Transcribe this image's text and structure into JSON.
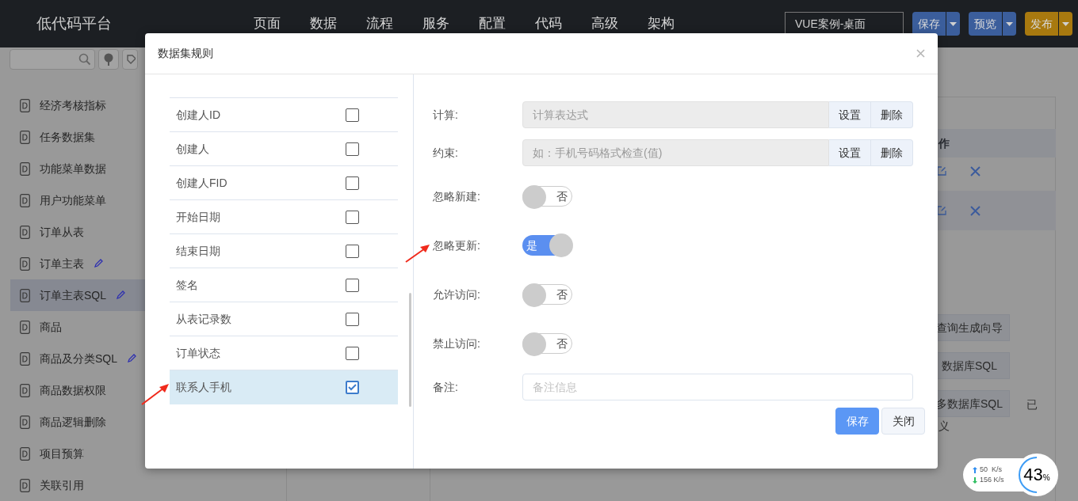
{
  "app": {
    "title": "低代码平台",
    "nav": [
      "页面",
      "数据",
      "流程",
      "服务",
      "配置",
      "代码",
      "高级",
      "架构"
    ],
    "project_select": "VUE案例-桌面",
    "buttons": [
      {
        "label": "保存",
        "color": "#3b5e9c"
      },
      {
        "label": "预览",
        "color": "#3b5e9c"
      },
      {
        "label": "发布",
        "color": "#a8790f"
      }
    ]
  },
  "sidebar": {
    "items": [
      {
        "label": "经济考核指标",
        "selected": false,
        "edited": false
      },
      {
        "label": "任务数据集",
        "selected": false,
        "edited": false
      },
      {
        "label": "功能菜单数据",
        "selected": false,
        "edited": false
      },
      {
        "label": "用户功能菜单",
        "selected": false,
        "edited": false
      },
      {
        "label": "订单从表",
        "selected": false,
        "edited": false
      },
      {
        "label": "订单主表",
        "selected": false,
        "edited": true
      },
      {
        "label": "订单主表SQL",
        "selected": true,
        "edited": true
      },
      {
        "label": "商品",
        "selected": false,
        "edited": false
      },
      {
        "label": "商品及分类SQL",
        "selected": false,
        "edited": true
      },
      {
        "label": "商品数据权限",
        "selected": false,
        "edited": false
      },
      {
        "label": "商品逻辑删除",
        "selected": false,
        "edited": false
      },
      {
        "label": "项目预算",
        "selected": false,
        "edited": false
      },
      {
        "label": "关联引用",
        "selected": false,
        "edited": false
      }
    ]
  },
  "main": {
    "table_header": "作",
    "buttons": [
      "查询生成向导",
      "数据库SQL",
      "多数据库SQL"
    ],
    "side_text": "已",
    "wrapped_text": "义"
  },
  "net_widget": {
    "upload": "50  K/s",
    "download": "156 K/s",
    "percent": "43",
    "percent_sign": "%"
  },
  "dialog": {
    "title": "数据集规则",
    "fields": [
      {
        "name": "创建人ID",
        "checked": false,
        "selected": false
      },
      {
        "name": "创建人",
        "checked": false,
        "selected": false
      },
      {
        "name": "创建人FID",
        "checked": false,
        "selected": false
      },
      {
        "name": "开始日期",
        "checked": false,
        "selected": false
      },
      {
        "name": "结束日期",
        "checked": false,
        "selected": false
      },
      {
        "name": "签名",
        "checked": false,
        "selected": false
      },
      {
        "name": "从表记录数",
        "checked": false,
        "selected": false
      },
      {
        "name": "订单状态",
        "checked": false,
        "selected": false
      },
      {
        "name": "联系人手机",
        "checked": true,
        "selected": true
      }
    ],
    "form": [
      {
        "kind": "expression",
        "label": "计算:",
        "placeholder": "计算表达式",
        "buttons": [
          "设置",
          "删除"
        ]
      },
      {
        "kind": "expression",
        "label": "约束:",
        "placeholder": "如：手机号码格式检查(值)",
        "buttons": [
          "设置",
          "删除"
        ]
      },
      {
        "kind": "toggle",
        "label": "忽略新建:",
        "on": false,
        "text": "否"
      },
      {
        "kind": "toggle",
        "label": "忽略更新:",
        "on": true,
        "text": "是"
      },
      {
        "kind": "toggle",
        "label": "允许访问:",
        "on": false,
        "text": "否"
      },
      {
        "kind": "toggle",
        "label": "禁止访问:",
        "on": false,
        "text": "否"
      },
      {
        "kind": "text",
        "label": "备注:",
        "placeholder": "备注信息"
      }
    ],
    "footer": [
      {
        "label": "保存",
        "kind": "primary"
      },
      {
        "label": "关闭",
        "kind": "default"
      }
    ]
  }
}
